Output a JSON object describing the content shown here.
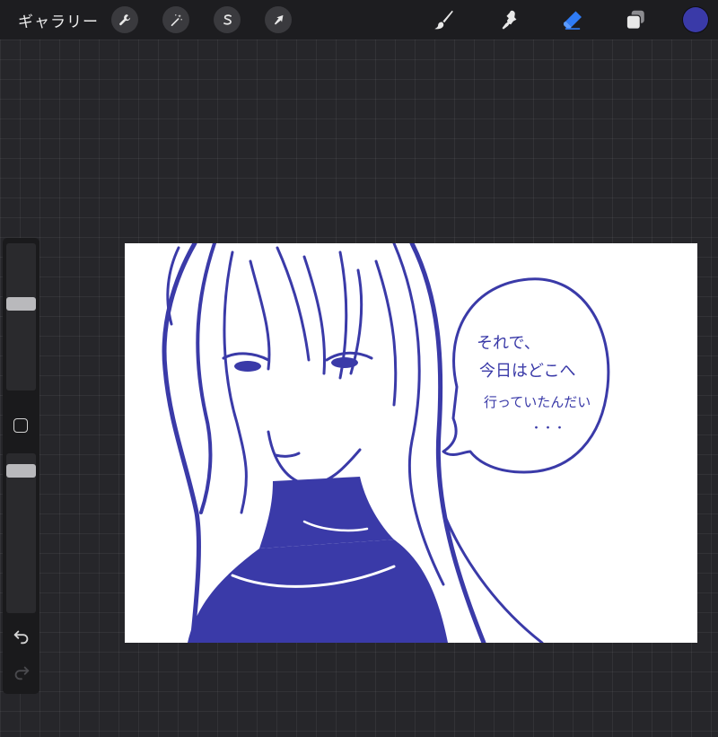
{
  "topbar": {
    "gallery_label": "ギャラリー",
    "actions": [
      {
        "icon": "wrench-icon",
        "name": "actions-button"
      },
      {
        "icon": "magic-wand-icon",
        "name": "adjustments-button"
      },
      {
        "icon": "selection-s-icon",
        "name": "selection-button"
      },
      {
        "icon": "arrow-cursor-icon",
        "name": "transform-button"
      }
    ],
    "tools": [
      {
        "icon": "brush-icon",
        "name": "brush-tool",
        "active": false
      },
      {
        "icon": "smudge-icon",
        "name": "smudge-tool",
        "active": false
      },
      {
        "icon": "eraser-icon",
        "name": "eraser-tool",
        "active": true
      },
      {
        "icon": "layers-icon",
        "name": "layers-tool",
        "active": false
      }
    ],
    "current_color": "#3a3aa8"
  },
  "sidebar": {
    "brush_size_icon": "slider-handle",
    "opacity_icon": "slider-handle",
    "modify_icon": "square-icon",
    "undo_icon": "undo-icon",
    "redo_icon": "redo-icon"
  },
  "canvas": {
    "ink_color": "#3a3aa8",
    "speech_lines": [
      "それで、",
      "今日はどこへ",
      "行っていたんだい",
      "・・・"
    ]
  },
  "colors": {
    "accent_active": "#2f7cf6",
    "topbar_bg": "#1d1d20",
    "workspace_bg": "#26262a"
  }
}
